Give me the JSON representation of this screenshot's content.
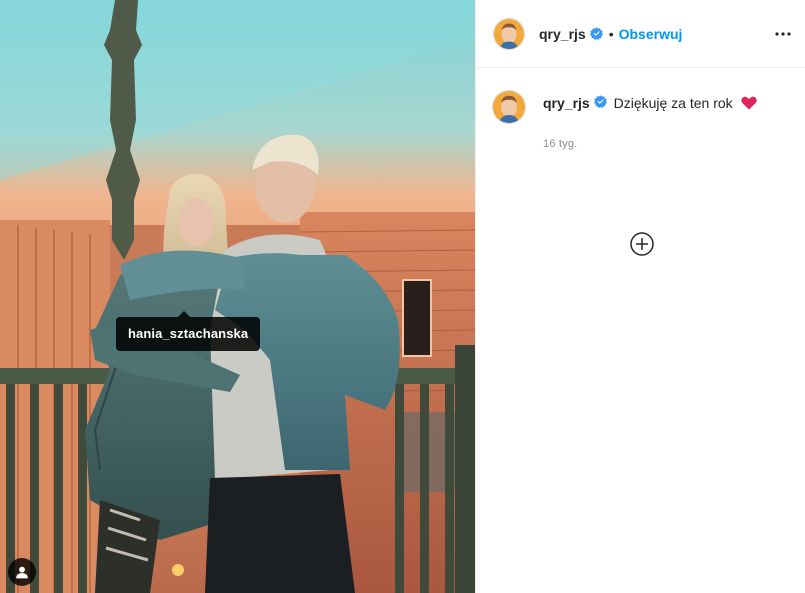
{
  "post": {
    "photo": {
      "tag_username": "hania_sztachanska",
      "tags_icon": "user-tag-icon"
    },
    "header": {
      "username": "qry_rjs",
      "verified_icon": "verified-badge-icon",
      "separator": "•",
      "follow_label": "Obserwuj",
      "more_icon": "more-options-icon"
    },
    "caption": {
      "username": "qry_rjs",
      "text": "Dziękuję za ten rok",
      "emoji": "heart-emoji-icon",
      "time": "16 tyg."
    },
    "load_more_icon": "add-circle-icon",
    "colors": {
      "link": "#0095f6",
      "verified": "#3897f0",
      "heart": "#e0245e",
      "border": "#efefef",
      "muted": "#8e8e8e"
    }
  }
}
